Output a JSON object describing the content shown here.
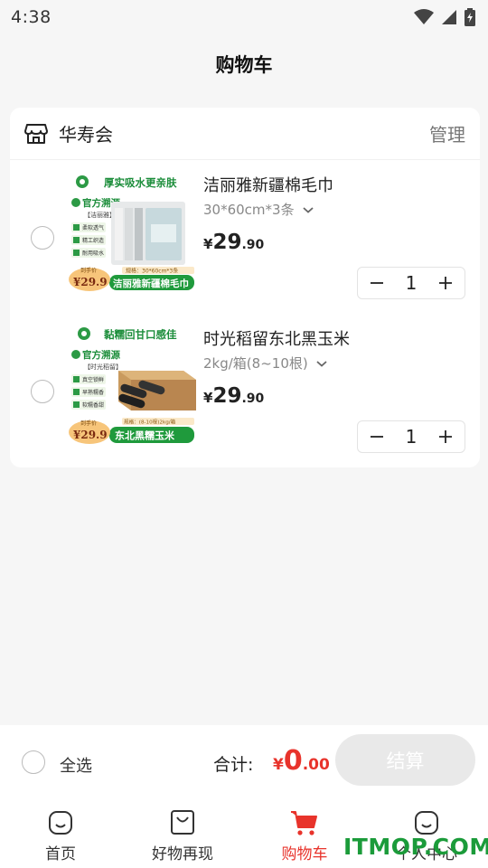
{
  "status_bar": {
    "time": "4:38"
  },
  "page": {
    "title": "购物车"
  },
  "store": {
    "name": "华寿会",
    "manage_label": "管理"
  },
  "items": [
    {
      "name": "洁丽雅新疆棉毛巾",
      "spec": "30*60cm*3条",
      "price_currency": "¥",
      "price_int": "29",
      "price_dec": ".90",
      "quantity": "1",
      "thumb": {
        "slogan": "厚实吸水更亲肤",
        "badge": "官方溯源",
        "brand": "【洁丽雅】",
        "features": [
          "柔软透气",
          "精工织造",
          "耐用吸水"
        ],
        "promo_price_label": "到手价",
        "promo_price": "¥29.9",
        "spec_note": "规格：30*60cm*3条",
        "banner": "洁丽雅新疆棉毛巾"
      }
    },
    {
      "name": "时光稻留东北黑玉米",
      "spec": "2kg/箱(8~10根)",
      "price_currency": "¥",
      "price_int": "29",
      "price_dec": ".90",
      "quantity": "1",
      "thumb": {
        "slogan": "黏糯回甘口感佳",
        "badge": "官方溯源",
        "brand": "【时光稻留】",
        "features": [
          "真空锁鲜",
          "早熟糯香",
          "软糯香甜"
        ],
        "promo_price_label": "到手价",
        "promo_price": "¥29.9",
        "spec_note": "规格：(8-10根)2kg/箱",
        "banner": "东北黑糯玉米"
      }
    }
  ],
  "checkout": {
    "select_all_label": "全选",
    "total_label": "合计:",
    "total_currency": "¥",
    "total_int": "0",
    "total_dec": ".00",
    "checkout_label": "结算"
  },
  "tabs": [
    {
      "label": "首页",
      "icon": "home-bag-icon",
      "active": false
    },
    {
      "label": "好物再现",
      "icon": "shopping-bag-icon",
      "active": false
    },
    {
      "label": "购物车",
      "icon": "cart-icon",
      "active": true
    },
    {
      "label": "个人中心",
      "icon": "profile-bag-icon",
      "active": false
    }
  ],
  "watermark": "ITMOP.COM",
  "colors": {
    "accent": "#e8332b",
    "green": "#1b9b3a",
    "promo_orange": "#f6b24a"
  }
}
